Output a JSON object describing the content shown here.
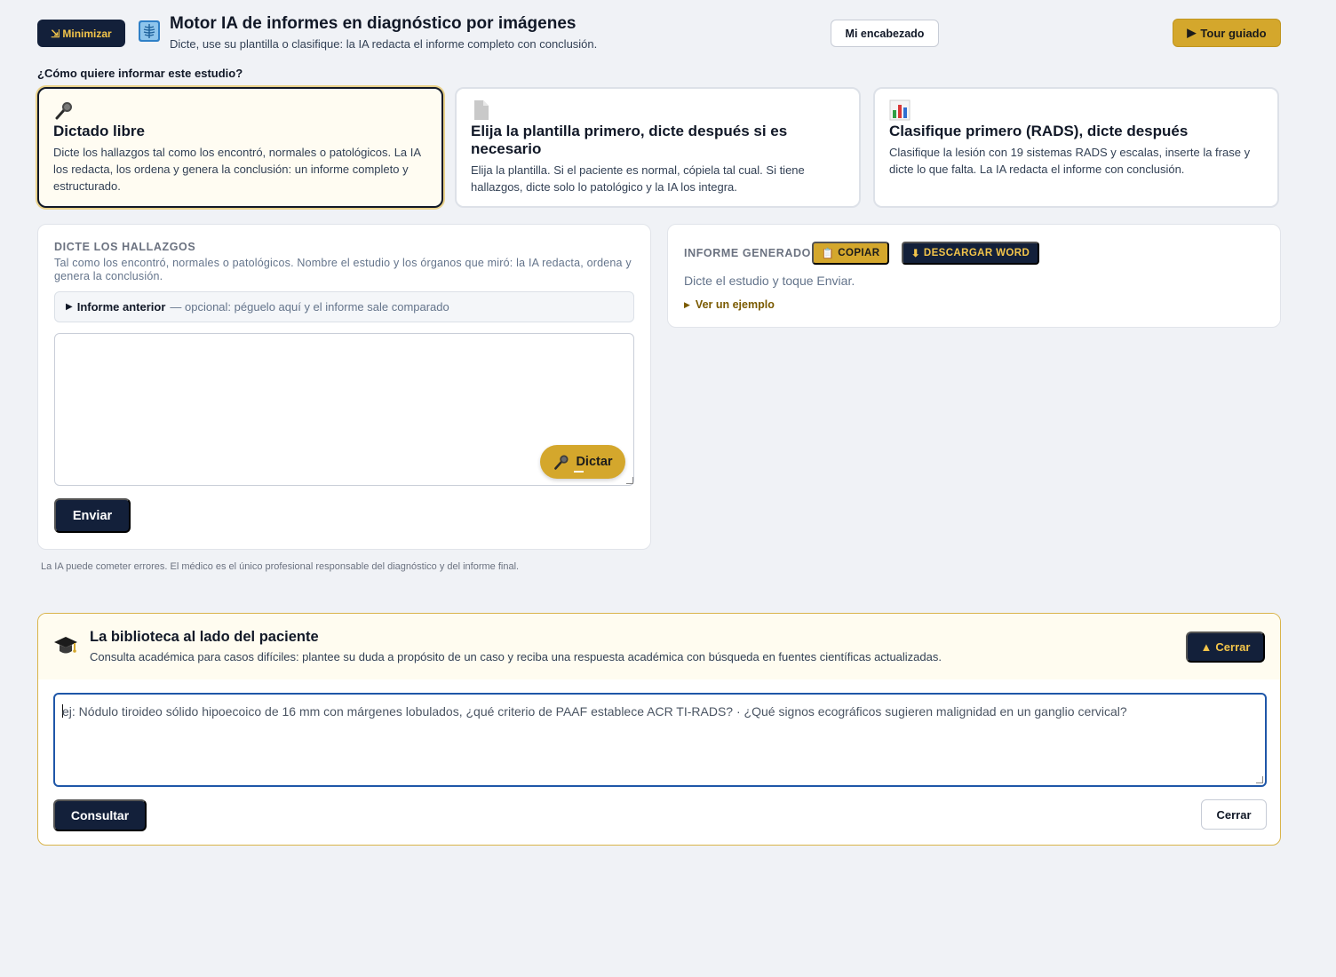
{
  "header": {
    "minimize_label": "Minimizar",
    "title": "Motor IA de informes en diagnóstico por imágenes",
    "subtitle": "Dicte, use su plantilla o clasifique: la IA redacta el informe completo con conclusión.",
    "my_header_label": "Mi encabezado",
    "tour_label": "Tour guiado",
    "icons": {
      "minimize": "arrow-down-right-icon",
      "logo": "xray-icon",
      "tour": "play-icon"
    }
  },
  "mode_question": "¿Cómo quiere informar este estudio?",
  "modes": [
    {
      "icon": "microphone-icon",
      "title": "Dictado libre",
      "description": "Dicte los hallazgos tal como los encontró, normales o patológicos. La IA los redacta, los ordena y genera la conclusión: un informe completo y estructurado.",
      "selected": true
    },
    {
      "icon": "document-icon",
      "title": "Elija la plantilla primero, dicte después si es necesario",
      "description": "Elija la plantilla. Si el paciente es normal, cópiela tal cual. Si tiene hallazgos, dicte solo lo patológico y la IA los integra.",
      "selected": false
    },
    {
      "icon": "bar-chart-icon",
      "title": "Clasifique primero (RADS), dicte después",
      "description": "Clasifique la lesión con 19 sistemas RADS y escalas, inserte la frase y dicte lo que falta. La IA redacta el informe con conclusión.",
      "selected": false
    }
  ],
  "dictation": {
    "label": "DICTE LOS HALLAZGOS",
    "hint": "Tal como los encontró, normales o patológicos. Nombre el estudio y los órganos que miró: la IA redacta, ordena y genera la conclusión.",
    "previous_report_title": "Informe anterior",
    "previous_report_hint": "— opcional: péguelo aquí y el informe sale comparado",
    "text_value": "",
    "dictate_label": "Dictar",
    "send_label": "Enviar"
  },
  "disclaimer": "La IA puede cometer errores. El médico es el único profesional responsable del diagnóstico y del informe final.",
  "report": {
    "label": "INFORME GENERADO",
    "copy_label": "COPIAR",
    "download_label": "DESCARGAR WORD",
    "placeholder": "Dicte el estudio y toque Enviar.",
    "example_link": "Ver un ejemplo"
  },
  "library": {
    "title": "La biblioteca al lado del paciente",
    "subtitle": "Consulta académica para casos difíciles: plantee su duda a propósito de un caso y reciba una respuesta académica con búsqueda en fuentes científicas actualizadas.",
    "close_top_label": "Cerrar",
    "query_placeholder": "ej: Nódulo tiroideo sólido hipoecoico de 16 mm con márgenes lobulados, ¿qué criterio de PAAF establece ACR TI-RADS? · ¿Qué signos ecográficos sugieren malignidad en un ganglio cervical?",
    "query_value": "",
    "consult_label": "Consultar",
    "close_bottom_label": "Cerrar",
    "icon": "graduation-cap-icon"
  },
  "colors": {
    "navy": "#13203a",
    "gold": "#d4a72c",
    "gold_text": "#f2c44a",
    "background": "#f0f2f6",
    "focus_blue": "#1f57a8"
  }
}
